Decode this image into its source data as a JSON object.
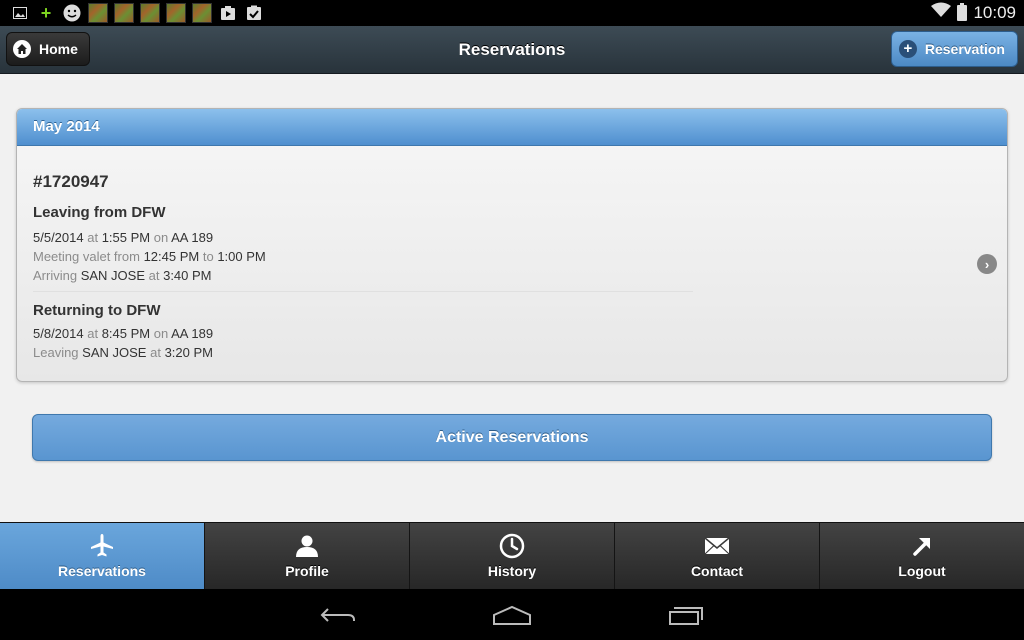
{
  "status_bar": {
    "time": "10:09",
    "icons": [
      "image-icon",
      "plus-icon",
      "smiley-icon",
      "thumbnail-1",
      "thumbnail-2",
      "thumbnail-3",
      "thumbnail-4",
      "thumbnail-5",
      "play-store-icon",
      "clipboard-check-icon",
      "wifi-icon",
      "battery-icon"
    ]
  },
  "header": {
    "title": "Reservations",
    "home_label": "Home",
    "add_label": "Reservation"
  },
  "card": {
    "month": "May 2014",
    "reservation_number": "#1720947",
    "leaving": {
      "title": "Leaving from DFW",
      "date": "5/5/2014",
      "at_word": "at",
      "time": "1:55 PM",
      "on_word": "on",
      "flight": "AA 189",
      "meeting_prefix": "Meeting valet from",
      "meeting_from": "12:45 PM",
      "to_word": "to",
      "meeting_to": "1:00 PM",
      "arriving_prefix": "Arriving",
      "arriving_city": "SAN JOSE",
      "arriving_at_word": "at",
      "arriving_time": "3:40 PM"
    },
    "returning": {
      "title": "Returning to DFW",
      "date": "5/8/2014",
      "at_word": "at",
      "time": "8:45 PM",
      "on_word": "on",
      "flight": "AA 189",
      "leaving_prefix": "Leaving",
      "leaving_city": "SAN JOSE",
      "leaving_at_word": "at",
      "leaving_time": "3:20 PM"
    }
  },
  "active_button_label": "Active Reservations",
  "tabs": [
    {
      "label": "Reservations",
      "icon": "airplane-icon",
      "active": true
    },
    {
      "label": "Profile",
      "icon": "person-icon",
      "active": false
    },
    {
      "label": "History",
      "icon": "clock-icon",
      "active": false
    },
    {
      "label": "Contact",
      "icon": "envelope-icon",
      "active": false
    },
    {
      "label": "Logout",
      "icon": "arrow-up-right-icon",
      "active": false
    }
  ],
  "colors": {
    "accent_blue": "#5995d0",
    "header_dark": "#28333b",
    "tabbar_dark": "#2b2b2b"
  }
}
